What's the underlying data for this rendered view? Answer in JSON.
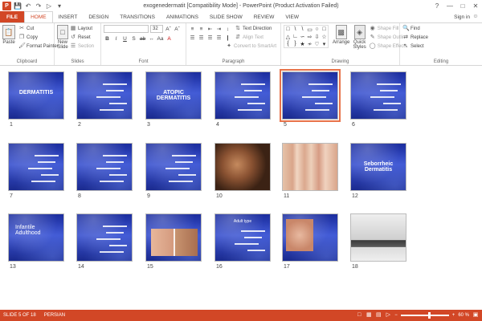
{
  "window": {
    "title": "exogenedermatit [Compatibility Mode] - PowerPoint (Product Activation Failed)",
    "app_logo": "P",
    "controls": [
      "?",
      "—",
      "□",
      "✕"
    ]
  },
  "qat": [
    "save-icon",
    "undo-icon",
    "redo-icon",
    "present-icon",
    "customize-icon"
  ],
  "tabs": [
    {
      "label": "FILE"
    },
    {
      "label": "HOME"
    },
    {
      "label": "INSERT"
    },
    {
      "label": "DESIGN"
    },
    {
      "label": "TRANSITIONS"
    },
    {
      "label": "ANIMATIONS"
    },
    {
      "label": "SLIDE SHOW"
    },
    {
      "label": "REVIEW"
    },
    {
      "label": "VIEW"
    }
  ],
  "signin": "Sign in",
  "ribbon": {
    "clipboard": {
      "paste": "Paste",
      "cut": "Cut",
      "copy": "Copy",
      "format_painter": "Format Painter",
      "label": "Clipboard"
    },
    "slides": {
      "new_slide_line1": "New",
      "new_slide_line2": "Slide",
      "layout": "Layout",
      "reset": "Reset",
      "section": "Section",
      "label": "Slides"
    },
    "font": {
      "font_name": "",
      "font_size": "32",
      "label": "Font"
    },
    "paragraph": {
      "text_direction": "Text Direction",
      "align_text": "Align Text",
      "convert": "Convert to SmartArt",
      "label": "Paragraph"
    },
    "drawing": {
      "arrange": "Arrange",
      "quick_styles_line1": "Quick",
      "quick_styles_line2": "Styles",
      "shape_fill": "Shape Fill",
      "shape_outline": "Shape Outline",
      "shape_effects": "Shape Effects",
      "label": "Drawing"
    },
    "editing": {
      "find": "Find",
      "replace": "Replace",
      "select": "Select",
      "label": "Editing"
    }
  },
  "slides": [
    {
      "num": "1",
      "title": "DERMATITIS",
      "kind": "title"
    },
    {
      "num": "2",
      "title": "",
      "kind": "text"
    },
    {
      "num": "3",
      "title": "ATOPIC\nDERMATITIS",
      "kind": "title"
    },
    {
      "num": "4",
      "title": "",
      "kind": "diagram"
    },
    {
      "num": "5",
      "title": "",
      "kind": "text",
      "selected": true
    },
    {
      "num": "6",
      "title": "",
      "kind": "text"
    },
    {
      "num": "7",
      "title": "",
      "kind": "text"
    },
    {
      "num": "8",
      "title": "",
      "kind": "text"
    },
    {
      "num": "9",
      "title": "",
      "kind": "text"
    },
    {
      "num": "10",
      "title": "",
      "kind": "photo-baby"
    },
    {
      "num": "11",
      "title": "",
      "kind": "photo-legs"
    },
    {
      "num": "12",
      "title": "Seborrheic Dermatitis",
      "kind": "title"
    },
    {
      "num": "13",
      "title": "Infantile\nAdulthood",
      "kind": "seb"
    },
    {
      "num": "14",
      "title": "",
      "kind": "text"
    },
    {
      "num": "15",
      "title": "",
      "kind": "photo-faces"
    },
    {
      "num": "16",
      "title": "Adult type",
      "kind": "text"
    },
    {
      "num": "17",
      "title": "",
      "kind": "photo-face"
    },
    {
      "num": "18",
      "title": "",
      "kind": "photo-laptop"
    }
  ],
  "status": {
    "slide_info": "SLIDE 5 OF 18",
    "language": "PERSIAN",
    "zoom": "60 %",
    "zoom_fraction": 0.6
  },
  "colors": {
    "accent": "#d24726",
    "slide_bg": "#2a3fb8",
    "selection": "#e8734a"
  }
}
